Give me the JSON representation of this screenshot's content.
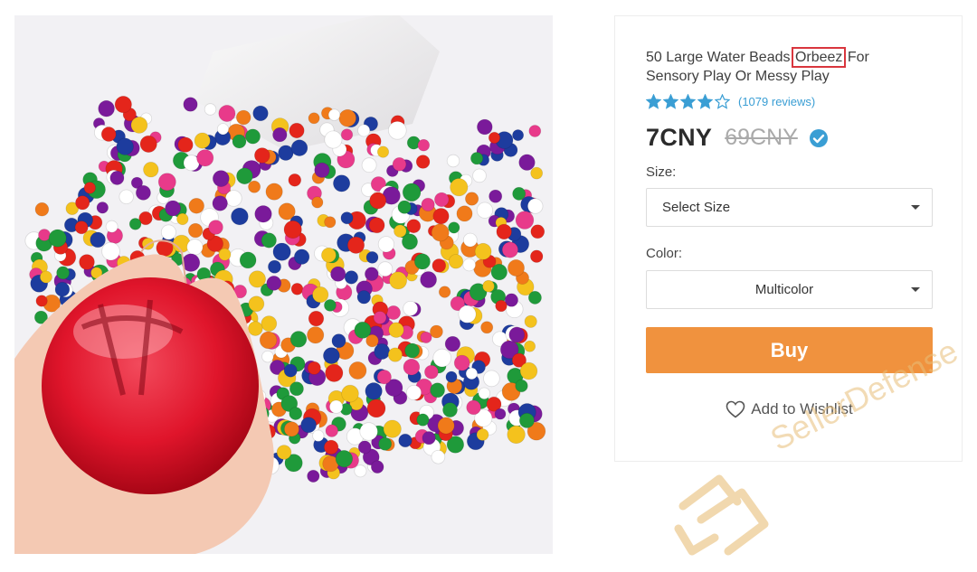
{
  "product": {
    "title_before": "50 Large Water Beads ",
    "title_highlight": "Orbeez",
    "title_after": " For Sensory Play Or Messy Play",
    "rating": 4,
    "rating_max": 5,
    "reviews": "(1079 reviews)",
    "price": "7CNY",
    "old_price": "69CNY"
  },
  "options": {
    "size_label": "Size:",
    "size_value": "Select Size",
    "color_label": "Color:",
    "color_value": "Multicolor"
  },
  "actions": {
    "buy_label": "Buy",
    "wishlist_label": "Add to Wishlist"
  },
  "watermark": {
    "text": "SellerDefense"
  },
  "colors": {
    "accent": "#f0923e",
    "star": "#3a9ed4",
    "highlight_box": "#d9363e",
    "verified": "#3a9ed4"
  },
  "icons": {
    "star_filled": "star-icon",
    "star_empty": "star-outline-icon",
    "verified": "verified-check-icon",
    "caret": "chevron-down-icon",
    "wishlist": "heart-icon"
  }
}
